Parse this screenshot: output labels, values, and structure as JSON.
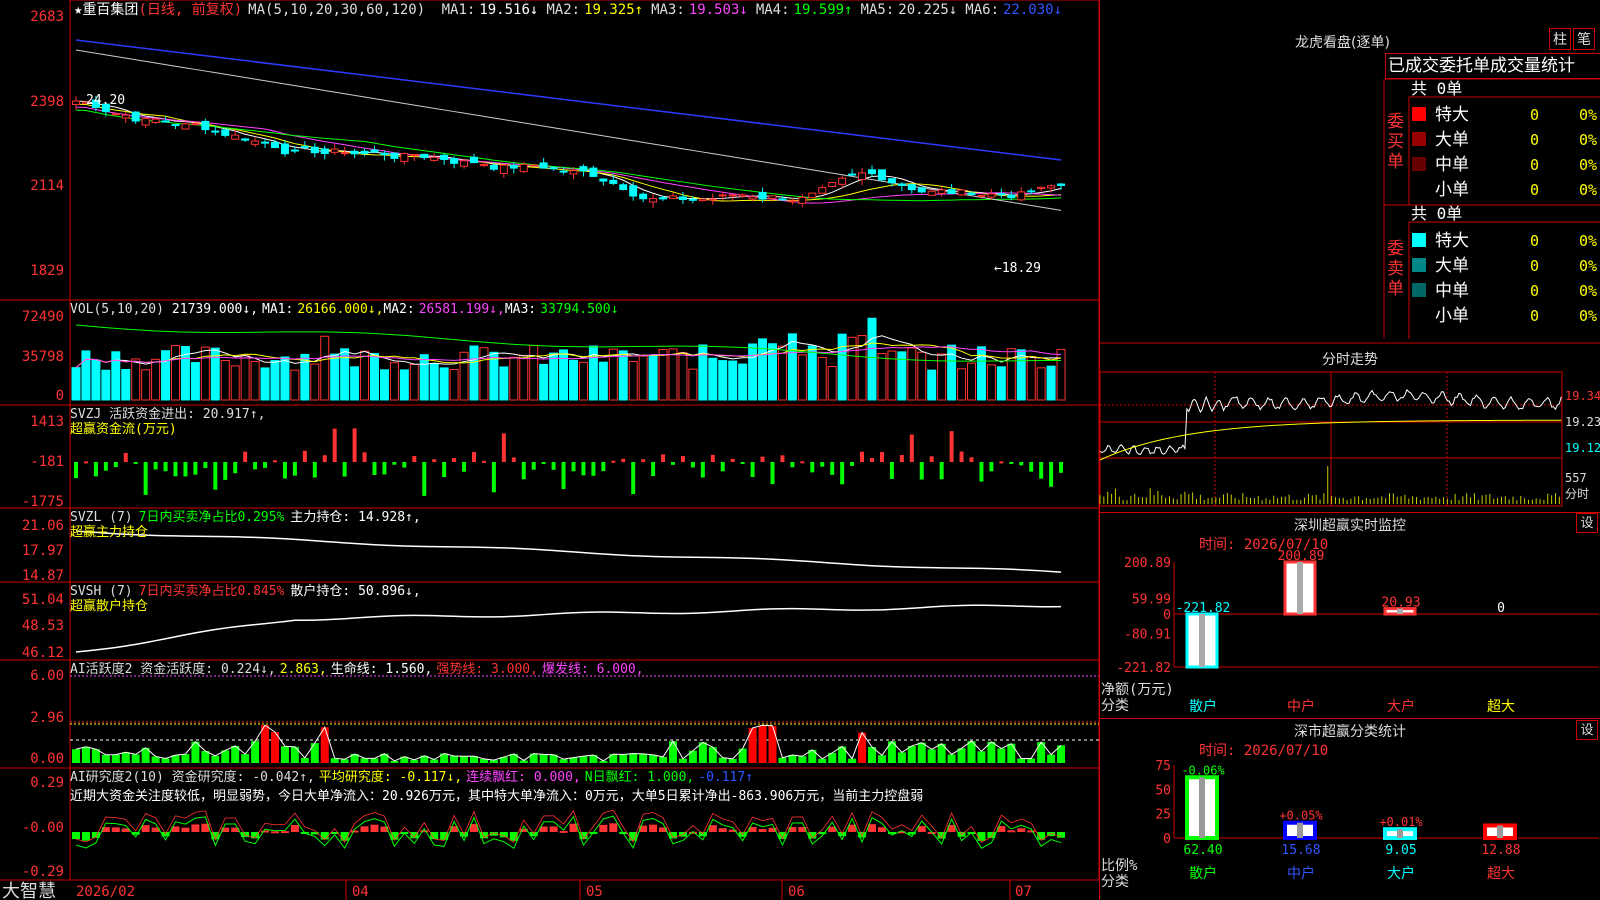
{
  "app": {
    "logo": "大智慧"
  },
  "stock": {
    "star": "★",
    "name": "重百集团",
    "mode": "(日线, 前复权)",
    "ma_label": "MA(5,10,20,30,60,120)",
    "ma_values": [
      {
        "label": "MA1:",
        "value": "19.516↓",
        "color": "#ffffff"
      },
      {
        "label": "MA2:",
        "value": "19.325↑",
        "color": "#ffff00"
      },
      {
        "label": "MA3:",
        "value": "19.503↓",
        "color": "#ff44ff"
      },
      {
        "label": "MA4:",
        "value": "19.599↑",
        "color": "#00ff00"
      },
      {
        "label": "MA5:",
        "value": "20.225↓",
        "color": "#dddddd"
      },
      {
        "label": "MA6:",
        "value": "22.030↓",
        "color": "#3355ff"
      }
    ],
    "high_note": "24.20",
    "low_note": "←18.29",
    "y_ticks": [
      "2683",
      "2398",
      "2114",
      "1829"
    ]
  },
  "volume": {
    "header": "VOL(5,10,20)",
    "value": "21739.000↓,",
    "ma": [
      {
        "label": "MA1:",
        "value": "26166.000↓,",
        "color": "#ffff00"
      },
      {
        "label": "MA2:",
        "value": "26581.199↓,",
        "color": "#ff44ff"
      },
      {
        "label": "MA3:",
        "value": "33794.500↓",
        "color": "#00ff00"
      }
    ],
    "y_ticks": [
      "72490",
      "35798",
      "0"
    ]
  },
  "svzj": {
    "line1": "SVZJ  活跃资金进出: 20.917↑,",
    "line2": "超赢资金流(万元)",
    "y_ticks": [
      "1413",
      "-181",
      "-1775"
    ]
  },
  "svzl": {
    "prefix": "SVZL (7)",
    "ratio": "7日内买卖净占比0.295%",
    "hold": "主力持仓: 14.928↑,",
    "line2": "超赢主力持仓",
    "y_ticks": [
      "21.06",
      "17.97",
      "14.87"
    ]
  },
  "svsh": {
    "prefix": "SVSH (7)",
    "ratio": "7日内买卖净占比0.845%",
    "hold": "散户持仓: 50.896↓,",
    "line2": "超赢散户持仓",
    "y_ticks": [
      "51.04",
      "48.53",
      "46.12"
    ]
  },
  "ai_active": {
    "header": "AI活跃度2 资金活跃度: 0.224↓,",
    "v2": "2.863,",
    "life": "生命线: 1.560,",
    "strong": "强势线: 3.000,",
    "burst": "爆发线: 6.000,",
    "y_ticks": [
      "6.00",
      "2.96",
      "0.00"
    ]
  },
  "ai_research": {
    "header": "AI研究度2(10) 资金研究度: -0.042↑,",
    "avg": "平均研究度: -0.117↓,",
    "cont": "连续飘红: 0.000,",
    "n": "N日飘红: 1.000,",
    "last": "-0.117↑",
    "comment": "近期大资金关注度较低，明显弱势，今日大单净流入：20.926万元，其中特大单净流入：0万元，大单5日累计净出-863.906万元，当前主力控盘弱",
    "y_ticks": [
      "0.29",
      "-0.00",
      "-0.29"
    ]
  },
  "x_axis": [
    "2026/02",
    "04",
    "05",
    "06",
    "07"
  ],
  "dragon": {
    "title": "龙虎看盘(逐单)",
    "btn1": "柱",
    "btn2": "笔",
    "tabs": "已成交委托单成交量统计",
    "buy_label": "委买单",
    "sell_label": "委卖单",
    "buy_total": "共 0单",
    "sell_total": "共 0单",
    "buy_rows": [
      {
        "label": "特大",
        "count": "0",
        "pct": "0%",
        "color": "#ff0000"
      },
      {
        "label": "大单",
        "count": "0",
        "pct": "0%",
        "color": "#990000"
      },
      {
        "label": "中单",
        "count": "0",
        "pct": "0%",
        "color": "#660000"
      },
      {
        "label": "小单",
        "count": "0",
        "pct": "0%",
        "color": "#000000"
      }
    ],
    "sell_rows": [
      {
        "label": "特大",
        "count": "0",
        "pct": "0%",
        "color": "#00ffff"
      },
      {
        "label": "大单",
        "count": "0",
        "pct": "0%",
        "color": "#008888"
      },
      {
        "label": "中单",
        "count": "0",
        "pct": "0%",
        "color": "#006666"
      },
      {
        "label": "小单",
        "count": "0",
        "pct": "0%",
        "color": "#000000"
      }
    ]
  },
  "intraday": {
    "title": "分时走势",
    "price_ticks": [
      "19.34",
      "19.23",
      "19.12"
    ],
    "vol_ticks": [
      "557",
      "分时"
    ]
  },
  "monitor": {
    "title": "深圳超赢实时监控",
    "set": "设",
    "time": "时间: 2026/07/10",
    "y_ticks": [
      "200.89",
      "59.99",
      "0",
      "-80.91",
      "-221.82"
    ],
    "ylabel1": "净额(万元)",
    "ylabel2": "分类",
    "categories": [
      "散户",
      "中户",
      "大户",
      "超大"
    ],
    "values": [
      -221.82,
      200.89,
      20.93,
      0
    ],
    "value_labels": [
      "-221.82",
      "200.89",
      "20.93",
      "0"
    ]
  },
  "classify": {
    "title": "深市超赢分类统计",
    "set": "设",
    "time": "时间: 2026/07/10",
    "y_ticks": [
      "75",
      "50",
      "25",
      "0"
    ],
    "ylabel1": "比例%",
    "ylabel2": "分类",
    "categories": [
      "散户",
      "中户",
      "大户",
      "超大"
    ],
    "values": [
      62.4,
      15.68,
      9.05,
      12.88
    ],
    "value_labels": [
      "62.40",
      "15.68",
      "9.05",
      "12.88"
    ],
    "changes": [
      "-0.06%",
      "+0.05%",
      "+0.01%",
      ""
    ],
    "colors": [
      "#00ff00",
      "#0000ff",
      "#00ffff",
      "#ff0000"
    ]
  }
}
